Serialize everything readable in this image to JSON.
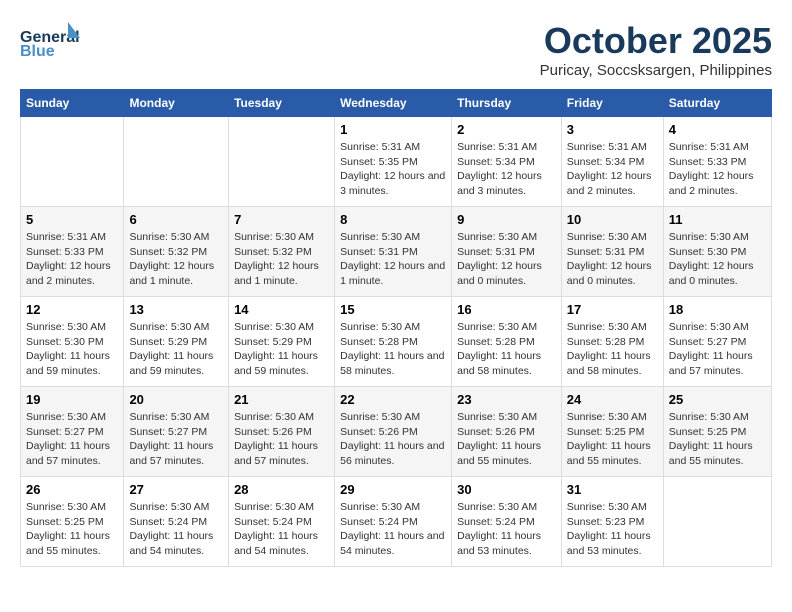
{
  "header": {
    "logo_line1": "General",
    "logo_line2": "Blue",
    "month": "October 2025",
    "location": "Puricay, Soccsksargen, Philippines"
  },
  "days_of_week": [
    "Sunday",
    "Monday",
    "Tuesday",
    "Wednesday",
    "Thursday",
    "Friday",
    "Saturday"
  ],
  "weeks": [
    [
      {
        "day": "",
        "info": ""
      },
      {
        "day": "",
        "info": ""
      },
      {
        "day": "",
        "info": ""
      },
      {
        "day": "1",
        "info": "Sunrise: 5:31 AM\nSunset: 5:35 PM\nDaylight: 12 hours and 3 minutes."
      },
      {
        "day": "2",
        "info": "Sunrise: 5:31 AM\nSunset: 5:34 PM\nDaylight: 12 hours and 3 minutes."
      },
      {
        "day": "3",
        "info": "Sunrise: 5:31 AM\nSunset: 5:34 PM\nDaylight: 12 hours and 2 minutes."
      },
      {
        "day": "4",
        "info": "Sunrise: 5:31 AM\nSunset: 5:33 PM\nDaylight: 12 hours and 2 minutes."
      }
    ],
    [
      {
        "day": "5",
        "info": "Sunrise: 5:31 AM\nSunset: 5:33 PM\nDaylight: 12 hours and 2 minutes."
      },
      {
        "day": "6",
        "info": "Sunrise: 5:30 AM\nSunset: 5:32 PM\nDaylight: 12 hours and 1 minute."
      },
      {
        "day": "7",
        "info": "Sunrise: 5:30 AM\nSunset: 5:32 PM\nDaylight: 12 hours and 1 minute."
      },
      {
        "day": "8",
        "info": "Sunrise: 5:30 AM\nSunset: 5:31 PM\nDaylight: 12 hours and 1 minute."
      },
      {
        "day": "9",
        "info": "Sunrise: 5:30 AM\nSunset: 5:31 PM\nDaylight: 12 hours and 0 minutes."
      },
      {
        "day": "10",
        "info": "Sunrise: 5:30 AM\nSunset: 5:31 PM\nDaylight: 12 hours and 0 minutes."
      },
      {
        "day": "11",
        "info": "Sunrise: 5:30 AM\nSunset: 5:30 PM\nDaylight: 12 hours and 0 minutes."
      }
    ],
    [
      {
        "day": "12",
        "info": "Sunrise: 5:30 AM\nSunset: 5:30 PM\nDaylight: 11 hours and 59 minutes."
      },
      {
        "day": "13",
        "info": "Sunrise: 5:30 AM\nSunset: 5:29 PM\nDaylight: 11 hours and 59 minutes."
      },
      {
        "day": "14",
        "info": "Sunrise: 5:30 AM\nSunset: 5:29 PM\nDaylight: 11 hours and 59 minutes."
      },
      {
        "day": "15",
        "info": "Sunrise: 5:30 AM\nSunset: 5:28 PM\nDaylight: 11 hours and 58 minutes."
      },
      {
        "day": "16",
        "info": "Sunrise: 5:30 AM\nSunset: 5:28 PM\nDaylight: 11 hours and 58 minutes."
      },
      {
        "day": "17",
        "info": "Sunrise: 5:30 AM\nSunset: 5:28 PM\nDaylight: 11 hours and 58 minutes."
      },
      {
        "day": "18",
        "info": "Sunrise: 5:30 AM\nSunset: 5:27 PM\nDaylight: 11 hours and 57 minutes."
      }
    ],
    [
      {
        "day": "19",
        "info": "Sunrise: 5:30 AM\nSunset: 5:27 PM\nDaylight: 11 hours and 57 minutes."
      },
      {
        "day": "20",
        "info": "Sunrise: 5:30 AM\nSunset: 5:27 PM\nDaylight: 11 hours and 57 minutes."
      },
      {
        "day": "21",
        "info": "Sunrise: 5:30 AM\nSunset: 5:26 PM\nDaylight: 11 hours and 57 minutes."
      },
      {
        "day": "22",
        "info": "Sunrise: 5:30 AM\nSunset: 5:26 PM\nDaylight: 11 hours and 56 minutes."
      },
      {
        "day": "23",
        "info": "Sunrise: 5:30 AM\nSunset: 5:26 PM\nDaylight: 11 hours and 55 minutes."
      },
      {
        "day": "24",
        "info": "Sunrise: 5:30 AM\nSunset: 5:25 PM\nDaylight: 11 hours and 55 minutes."
      },
      {
        "day": "25",
        "info": "Sunrise: 5:30 AM\nSunset: 5:25 PM\nDaylight: 11 hours and 55 minutes."
      }
    ],
    [
      {
        "day": "26",
        "info": "Sunrise: 5:30 AM\nSunset: 5:25 PM\nDaylight: 11 hours and 55 minutes."
      },
      {
        "day": "27",
        "info": "Sunrise: 5:30 AM\nSunset: 5:24 PM\nDaylight: 11 hours and 54 minutes."
      },
      {
        "day": "28",
        "info": "Sunrise: 5:30 AM\nSunset: 5:24 PM\nDaylight: 11 hours and 54 minutes."
      },
      {
        "day": "29",
        "info": "Sunrise: 5:30 AM\nSunset: 5:24 PM\nDaylight: 11 hours and 54 minutes."
      },
      {
        "day": "30",
        "info": "Sunrise: 5:30 AM\nSunset: 5:24 PM\nDaylight: 11 hours and 53 minutes."
      },
      {
        "day": "31",
        "info": "Sunrise: 5:30 AM\nSunset: 5:23 PM\nDaylight: 11 hours and 53 minutes."
      },
      {
        "day": "",
        "info": ""
      }
    ]
  ]
}
